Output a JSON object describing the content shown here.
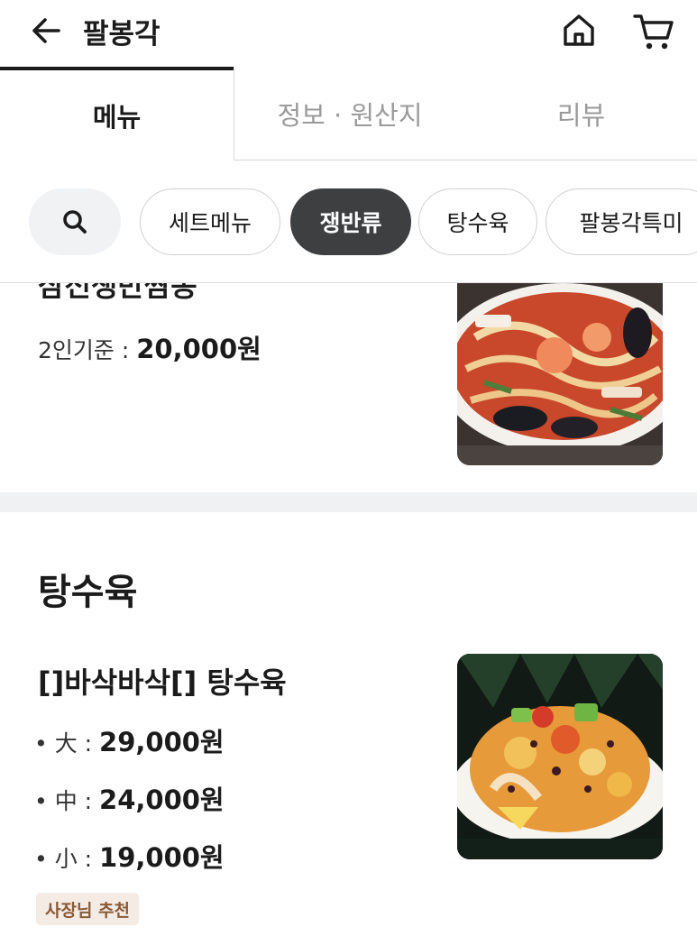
{
  "header": {
    "title": "팔봉각",
    "back_icon": "arrow-left-icon",
    "home_icon": "home-icon",
    "cart_icon": "cart-icon"
  },
  "tabs": [
    {
      "label": "메뉴",
      "active": true
    },
    {
      "label": "정보 · 원산지",
      "active": false
    },
    {
      "label": "리뷰",
      "active": false
    }
  ],
  "categories": {
    "search_icon": "search-icon",
    "chips": [
      {
        "label": "세트메뉴",
        "active": false
      },
      {
        "label": "쟁반류",
        "active": true
      },
      {
        "label": "탕수육",
        "active": false
      },
      {
        "label": "팔봉각특미",
        "active": false
      }
    ]
  },
  "previous_item": {
    "name_partial": "삼선쟁반짬뽕",
    "price_label": "2인기준 : ",
    "price": "20,000원"
  },
  "section": {
    "title": "탕수육",
    "item": {
      "name": "[]바삭바삭[] 탕수육",
      "sizes": [
        {
          "label": "• 大 : ",
          "price": "29,000원"
        },
        {
          "label": "• 中 : ",
          "price": "24,000원"
        },
        {
          "label": "• 小 : ",
          "price": "19,000원"
        }
      ],
      "badge": "사장님 추천"
    }
  },
  "colors": {
    "active_chip": "#3e3f41",
    "badge_bg": "#f3ebe4",
    "badge_text": "#8a5a38",
    "divider": "#f0f1f3"
  }
}
